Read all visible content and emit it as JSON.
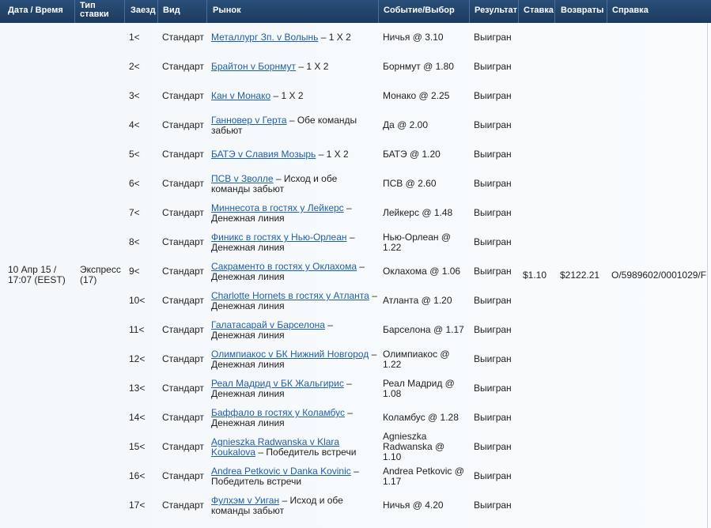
{
  "headers": {
    "date_time": "Дата  /  Время",
    "bet_type_1": "Тип",
    "bet_type_2": "ставки",
    "leg": "Заезд",
    "kind": "Вид",
    "market": "Рынок",
    "selection": "Событие/Выбор",
    "result": "Результат",
    "stake": "Ставка",
    "returns": "Возвраты",
    "reference": "Справка"
  },
  "bet": {
    "date_line1": "10 Апр 15 /",
    "date_line2": "17:07 (EEST)",
    "type_line1": "Экспресс",
    "type_line2": "(17)",
    "stake": "$1.10",
    "returns": "$2122.21",
    "reference": "O/5989602/0001029/F"
  },
  "legs": [
    {
      "leg": "1<",
      "kind": "Стандарт",
      "event": "Металлург Зп. v Волынь",
      "market": " –  1 X 2",
      "sel1": "Ничья @ 3.10",
      "sel2": "",
      "sel3": "",
      "result": "Выигран"
    },
    {
      "leg": "2<",
      "kind": "Стандарт",
      "event": "Брайтон v Борнмут",
      "market": " –  1 X 2",
      "sel1": "Борнмут @ 1.80",
      "sel2": "",
      "sel3": "",
      "result": "Выигран"
    },
    {
      "leg": "3<",
      "kind": "Стандарт",
      "event": "Кан v Монако",
      "market": " –  1 X 2",
      "sel1": "Монако @ 2.25",
      "sel2": "",
      "sel3": "",
      "result": "Выигран"
    },
    {
      "leg": "4<",
      "kind": "Стандарт",
      "event": "Ганновер v Герта",
      "market": " –  Обе команды забьют",
      "sel1": "Да @ 2.00",
      "sel2": "",
      "sel3": "",
      "result": "Выигран"
    },
    {
      "leg": "5<",
      "kind": "Стандарт",
      "event": "БАТЭ v Славия Мозырь",
      "market": " –  1 X 2",
      "sel1": "БАТЭ @ 1.20",
      "sel2": "",
      "sel3": "",
      "result": "Выигран"
    },
    {
      "leg": "6<",
      "kind": "Стандарт",
      "event": "ПСВ v Зволле",
      "market": " –  Исход и обе команды забьют",
      "sel1": "ПСВ @ 2.60",
      "sel2": "",
      "sel3": "",
      "result": "Выигран"
    },
    {
      "leg": "7<",
      "kind": "Стандарт",
      "event": "Миннесота в гостях у Лейкерс",
      "market": " –  Денежная линия",
      "sel1": "Лейкерс @ 1.48",
      "sel2": "",
      "sel3": "",
      "result": "Выигран"
    },
    {
      "leg": "8<",
      "kind": "Стандарт",
      "event": "Финикс в гостях у Нью-Орлеан",
      "market": " –  Денежная линия",
      "sel1": "Нью-Орлеан @",
      "sel2": "1.22",
      "sel3": "",
      "result": "Выигран"
    },
    {
      "leg": "9<",
      "kind": "Стандарт",
      "event": "Сакраменто в гостях у Оклахома",
      "market": " –  Денежная линия",
      "sel1": "Оклахома @ 1.06",
      "sel2": "",
      "sel3": "",
      "result": "Выигран"
    },
    {
      "leg": "10<",
      "kind": "Стандарт",
      "event": "Charlotte Hornets в гостях у Атланта",
      "market": " –  Денежная линия",
      "sel1": "Атланта @ 1.20",
      "sel2": "",
      "sel3": "",
      "result": "Выигран"
    },
    {
      "leg": "11<",
      "kind": "Стандарт",
      "event": "Галатасарай v Барселона",
      "market": " –  Денежная линия",
      "sel1": "Барселона @ 1.17",
      "sel2": "",
      "sel3": "",
      "result": "Выигран"
    },
    {
      "leg": "12<",
      "kind": "Стандарт",
      "event": "Олимпиакос v БК Нижний Новгород",
      "market": " –  Денежная линия",
      "sel1": "Олимпиакос @",
      "sel2": "1.22",
      "sel3": "",
      "result": "Выигран"
    },
    {
      "leg": "13<",
      "kind": "Стандарт",
      "event": "Реал Мадрид v БК Жальгирис",
      "market": " –  Денежная линия",
      "sel1": "Реал Мадрид @",
      "sel2": "1.08",
      "sel3": "",
      "result": "Выигран"
    },
    {
      "leg": "14<",
      "kind": "Стандарт",
      "event": "Баффало в гостях у Коламбус",
      "market": " –  Денежная линия",
      "sel1": "Коламбус @ 1.28",
      "sel2": "",
      "sel3": "",
      "result": "Выигран"
    },
    {
      "leg": "15<",
      "kind": "Стандарт",
      "event": "Agnieszka Radwanska v Klara Koukalova",
      "market": " –  Победитель встречи",
      "sel1": "Agnieszka",
      "sel2": "Radwanska @",
      "sel3": "1.10",
      "result": "Выигран"
    },
    {
      "leg": "16<",
      "kind": "Стандарт",
      "event": "Andrea Petkovic v Danka Kovinic",
      "market": " –  Победитель встречи",
      "sel1": "Andrea Petkovic @",
      "sel2": "1.17",
      "sel3": "",
      "result": "Выигран"
    },
    {
      "leg": "17<",
      "kind": "Стандарт",
      "event": "Фулхэм v Уиган",
      "market": " –  Исход и обе команды забьют",
      "sel1": "Ничья @ 4.20",
      "sel2": "",
      "sel3": "",
      "result": "Выигран"
    }
  ]
}
